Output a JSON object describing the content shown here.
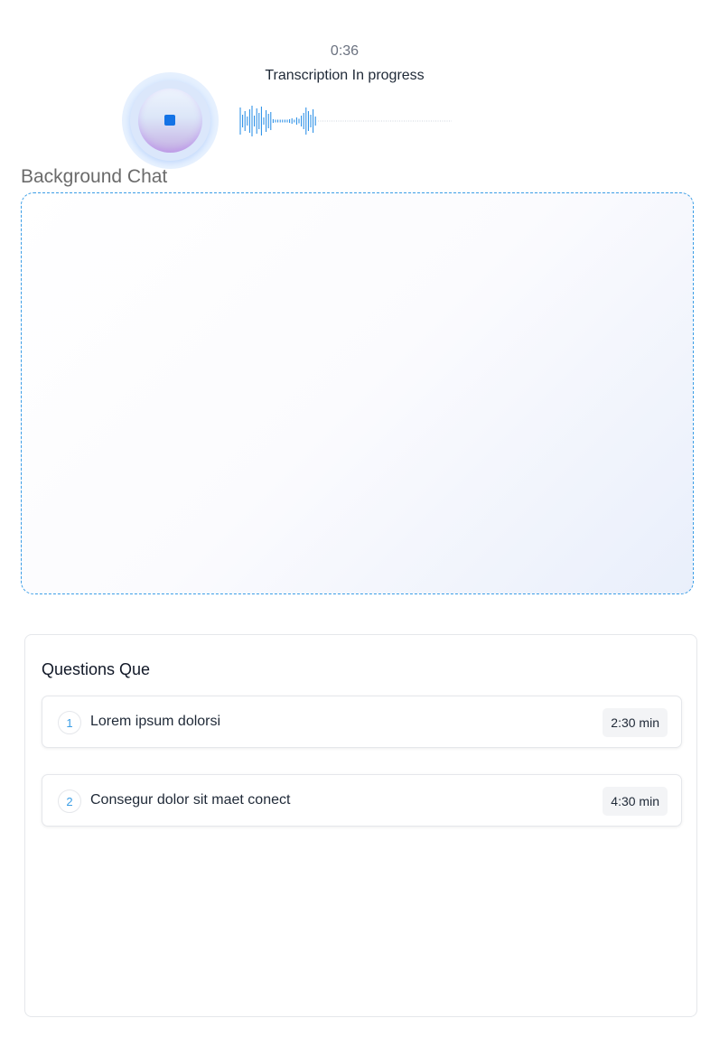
{
  "recorder": {
    "timer": "0:36",
    "status": "Transcription In progress",
    "stop_icon": "stop-icon",
    "accent_color": "#1473e6",
    "waveform_color": "#1e88e5"
  },
  "background_chat": {
    "title": "Background Chat",
    "border_color": "#3b9ee6"
  },
  "questions": {
    "title": "Questions Que",
    "items": [
      {
        "number": "1",
        "text": "Lorem ipsum dolorsi",
        "duration": "2:30 min"
      },
      {
        "number": "2",
        "text": "Consegur dolor sit maet conect",
        "duration": "4:30 min"
      }
    ]
  }
}
